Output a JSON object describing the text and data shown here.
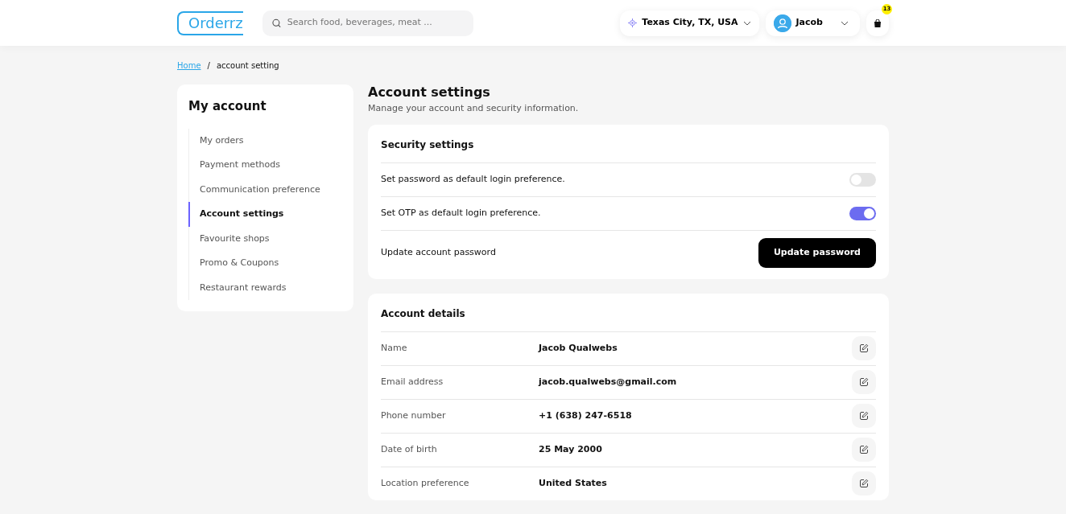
{
  "header": {
    "logo": "Orderrz",
    "search": {
      "placeholder": "Search food, beverages, meat ..."
    },
    "location": "Texas City, TX, USA",
    "user": "Jacob",
    "cart_count": "13"
  },
  "breadcrumb": {
    "items": [
      "Home",
      "account setting"
    ],
    "separator": "/"
  },
  "sidebar": {
    "title": "My account",
    "items": [
      {
        "label": "My orders",
        "selected": false
      },
      {
        "label": "Payment methods",
        "selected": false
      },
      {
        "label": "Communication preference",
        "selected": false
      },
      {
        "label": "Account settings",
        "selected": true
      },
      {
        "label": "Favourite shops",
        "selected": false
      },
      {
        "label": "Promo & Coupons",
        "selected": false
      },
      {
        "label": "Restaurant rewards",
        "selected": false
      }
    ]
  },
  "page": {
    "title": "Account settings",
    "subtitle": "Manage your account and security information."
  },
  "security": {
    "title": "Security settings",
    "rows": [
      {
        "kind": "toggle",
        "label": "Set password as default login preference.",
        "on": false
      },
      {
        "kind": "toggle",
        "label": "Set OTP as default login preference.",
        "on": true
      },
      {
        "kind": "button",
        "label": "Update account password",
        "button": "Update password"
      }
    ]
  },
  "details": {
    "title": "Account details",
    "rows": [
      {
        "label": "Name",
        "value": "Jacob Qualwebs"
      },
      {
        "label": "Email address",
        "value": "jacob.qualwebs@gmail.com"
      },
      {
        "label": "Phone number",
        "value": "+1 (638) 247-6518"
      },
      {
        "label": "Date of birth",
        "value": "25 May 2000"
      },
      {
        "label": "Location preference",
        "value": "United States"
      }
    ]
  }
}
